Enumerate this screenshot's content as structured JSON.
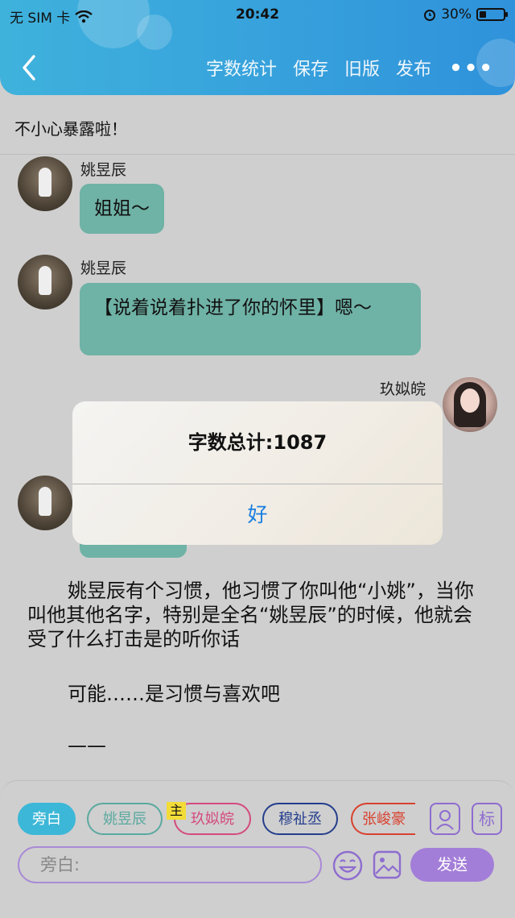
{
  "status_bar": {
    "carrier": "无 SIM 卡",
    "time": "20:42",
    "battery": "30%",
    "battery_level": 0.3
  },
  "nav": {
    "word_count": "字数统计",
    "save": "保存",
    "old_version": "旧版",
    "publish": "发布",
    "more": "•••"
  },
  "chapter_title": "不小心暴露啦！",
  "messages": [
    {
      "name": "姚昱辰",
      "text": "姐姐～"
    },
    {
      "name": "姚昱辰",
      "text": "【说着说着扑进了你的怀里】嗯～"
    },
    {
      "name": "玖姒皖"
    }
  ],
  "narration": {
    "p1": "姚昱辰有个习惯，他习惯了你叫他“小姚”，当你叫他其他名字，特别是全名“姚昱辰”的时候，他就会受了什么打击是的听你话",
    "p2": "可能……是习惯与喜欢吧",
    "p3": "——"
  },
  "alert": {
    "message": "字数总计:1087",
    "ok": "好"
  },
  "roles": [
    {
      "label": "旁白",
      "color": "#3cb7d7"
    },
    {
      "label": "姚昱辰",
      "color": "#5aa99f"
    },
    {
      "label": "玖姒皖",
      "color": "#d44a7e"
    },
    {
      "label": "穆祉丞",
      "color": "#243e8c"
    },
    {
      "label": "张峻豪",
      "color": "#d8412f"
    }
  ],
  "main_badge": "主",
  "tag_button": "标",
  "input": {
    "placeholder": "旁白:"
  },
  "send_label": "发送"
}
